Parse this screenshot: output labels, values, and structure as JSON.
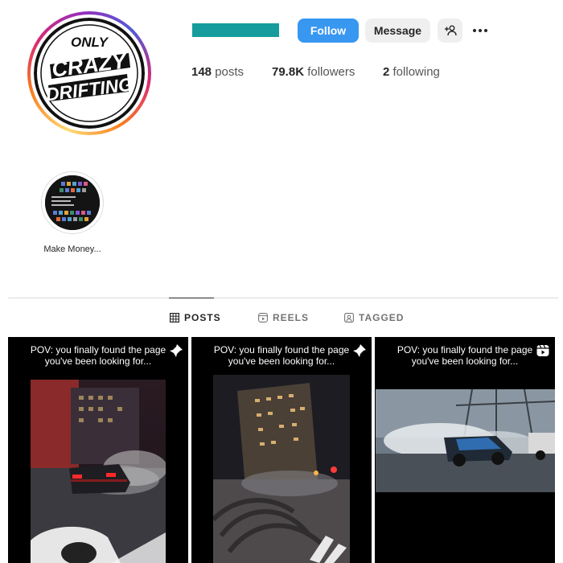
{
  "profile": {
    "stats": [
      {
        "count": "148",
        "label": "posts"
      },
      {
        "count": "79.8K",
        "label": "followers"
      },
      {
        "count": "2",
        "label": "following"
      }
    ],
    "logo_text": [
      "ONLY",
      "CRAZY",
      "DRIFTING"
    ],
    "username_bar_color": "#169c9c"
  },
  "actions": {
    "follow_label": "Follow",
    "message_label": "Message",
    "add_user_icon": "add-user-icon",
    "more_icon": "more-options-icon",
    "follow_color": "#3897f0"
  },
  "highlights": [
    {
      "label": "Make Money...",
      "icon": "highlight-cover"
    }
  ],
  "tabs": [
    {
      "label": "POSTS",
      "icon": "grid-icon",
      "active": true
    },
    {
      "label": "REELS",
      "icon": "reels-icon",
      "active": false
    },
    {
      "label": "TAGGED",
      "icon": "tagged-icon",
      "active": false
    }
  ],
  "posts": [
    {
      "caption_line1": "POV: you finally found the page",
      "caption_line2": "you've been looking for...",
      "badge": "pin-icon"
    },
    {
      "caption_line1": "POV: you finally found the page",
      "caption_line2": "you've been looking for...",
      "badge": "pin-icon"
    },
    {
      "caption_line1": "POV: you finally found the page",
      "caption_line2": "you've been looking for...",
      "badge": "reel-icon"
    }
  ]
}
